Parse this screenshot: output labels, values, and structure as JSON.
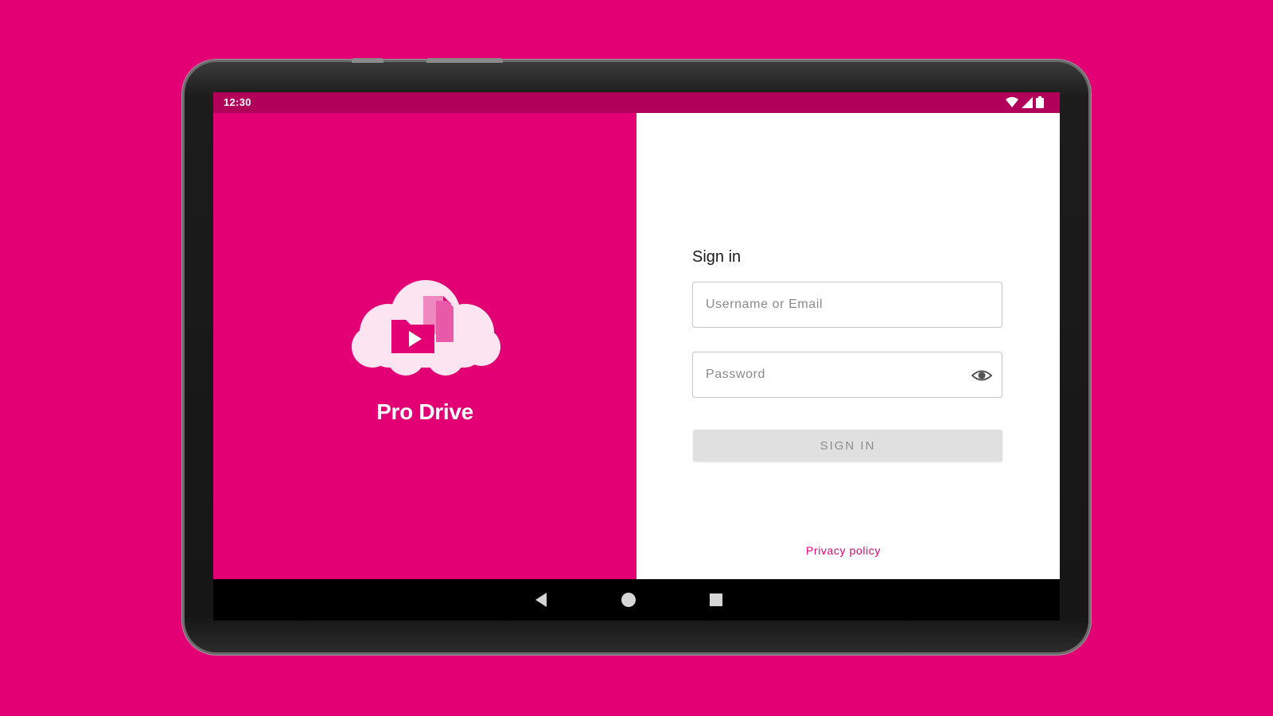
{
  "status_bar": {
    "time": "12:30",
    "icons": [
      "wifi-icon",
      "signal-icon",
      "battery-icon"
    ]
  },
  "brand": {
    "name": "Pro Drive",
    "logo_icon": "cloud-files-icon"
  },
  "signin": {
    "title": "Sign in",
    "username_placeholder": "Username or Email",
    "username_value": "",
    "password_placeholder": "Password",
    "password_value": "",
    "password_toggle_icon": "eye-icon",
    "button_label": "SIGN IN",
    "privacy_link": "Privacy policy"
  },
  "nav_bar": {
    "icons": [
      "back-icon",
      "home-icon",
      "recents-icon"
    ]
  },
  "colors": {
    "brand_magenta": "#e20074",
    "status_bar": "#b0005a",
    "button_disabled": "#e0e0e0"
  }
}
